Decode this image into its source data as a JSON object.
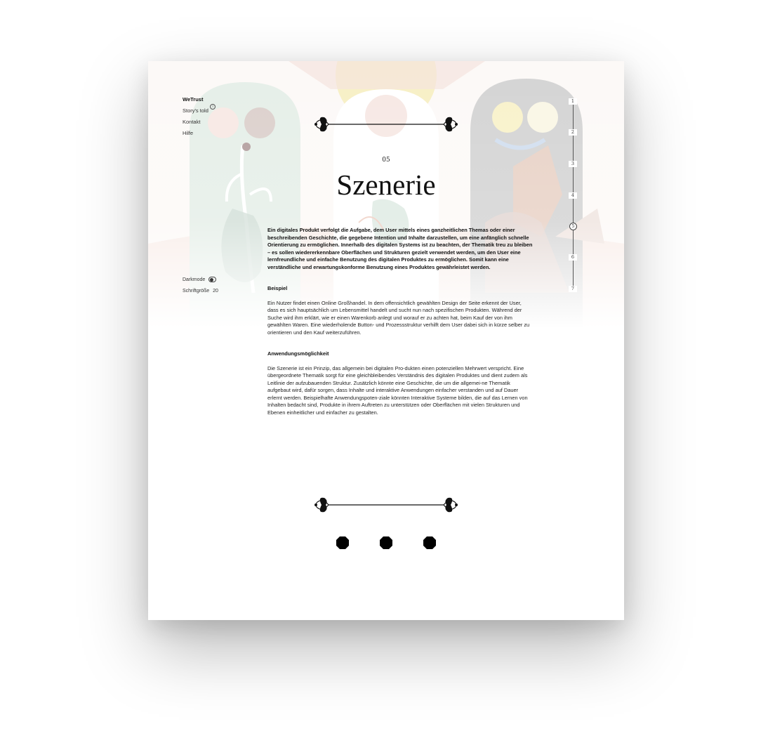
{
  "nav": {
    "items": [
      {
        "label": "WeTrust",
        "active": true
      },
      {
        "label": "Story's told",
        "badge": "i"
      },
      {
        "label": "Kontakt"
      },
      {
        "label": "Hilfe"
      }
    ]
  },
  "settings": {
    "darkmode_label": "Darkmode",
    "fontsize_label": "Schriftgröße",
    "fontsize_value": "20"
  },
  "steps": [
    "1",
    "2",
    "3",
    "4",
    "5",
    "6",
    "7"
  ],
  "current_step": "5",
  "chapter": {
    "number": "05",
    "title": "Szenerie",
    "intro": "Ein digitales Produkt verfolgt die Aufgabe, dem User mittels eines ganzheitlichen Themas oder einer beschreibenden Geschichte, die gegebene Intention und Inhalte darzustellen, um eine anfänglich schnelle Orientierung zu ermöglichen. Innerhalb des digitalen Systems ist zu beachten, der Thematik treu zu bleiben – es sollen wiedererkennbare Oberflächen und Strukturen gezielt verwendet werden, um den User eine lernfreundliche und einfache Benutzung des digitalen Produktes zu ermöglichen. Somit kann eine verständliche und erwartungskonforme Benutzung eines Produktes gewährleistet werden.",
    "sections": [
      {
        "heading": "Beispiel",
        "text": "Ein Nutzer findet einen Online Großhandel. In dem offensichtlich gewählten Design der Seite erkennt der User, dass es sich hauptsächlich um Lebensmittel handelt und sucht nun nach spezifischen Produkten. Während der Suche wird ihm erklärt, wie er einen Warenkorb anlegt und worauf er zu achten hat, beim Kauf der von ihm gewählten Waren. Eine wiederholende Button- und Prozessstruktur verhilft dem User dabei sich in kürze selber zu orientieren und den Kauf weiterzuführen."
      },
      {
        "heading": "Anwendungsmöglichkeit",
        "text": "Die Szenerie ist ein Prinzip, das allgemein bei digitalen Pro-dukten einen potenziellen Mehrwert verspricht. Eine übergeordnete Thematik sorgt für eine gleichbleibendes Verständnis des digitalen Produktes und dient zudem als Leitlinie der aufzubauenden Struktur. Zusätzlich könnte eine Geschichte, die um die allgemei-ne Thematik aufgebaut wird, dafür sorgen, dass Inhalte und interaktive Anwendungen einfacher verstanden und auf Dauer erlernt werden. Beispielhafte Anwendungspoten-ziale könnten Interaktive Systeme bilden, die auf das Lernen von Inhalten bedacht sind, Produkte in ihrem Auftreten zu unterstützen oder Oberflächen mit vielen Strukturen und Ebenen einheitlicher und einfacher zu gestalten."
      }
    ]
  },
  "colors": {
    "text": "#111111",
    "arch_left": "#cfe0d6",
    "arch_right": "#9e9e9e",
    "sun": "#f3e7a6",
    "pink": "#f2d9d2",
    "yellow": "#f5ebaf",
    "blue": "#b9cde6"
  }
}
